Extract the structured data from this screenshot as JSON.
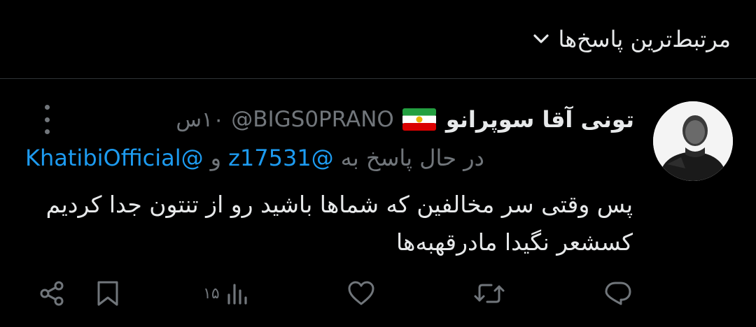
{
  "sort": {
    "label": "مرتبط‌ترین پاسخ‌ها"
  },
  "tweet": {
    "display_name": "تونی آقا سوپرانو",
    "handle": "@BIGS0PRANO",
    "time": "۱۰س",
    "reply_prefix": "در حال پاسخ به",
    "mention_1": "@z17531",
    "conjunction": "و",
    "mention_2": "@KhatibiOfficial",
    "text": "پس وقتی سر مخالفین که شماها باشید رو از تنتون جدا کردیم کسشعر نگیدا مادرقهبه‌ها"
  },
  "actions": {
    "views": "۱۵"
  },
  "colors": {
    "background": "#000000",
    "text": "#e7e9ea",
    "muted": "#71767b",
    "accent": "#1d9bf0",
    "divider": "#2f3336"
  },
  "icons": [
    "chevron-down-icon",
    "more-icon",
    "flag-icon",
    "reply-icon",
    "retweet-icon",
    "like-icon",
    "views-icon",
    "bookmark-icon",
    "share-icon"
  ]
}
